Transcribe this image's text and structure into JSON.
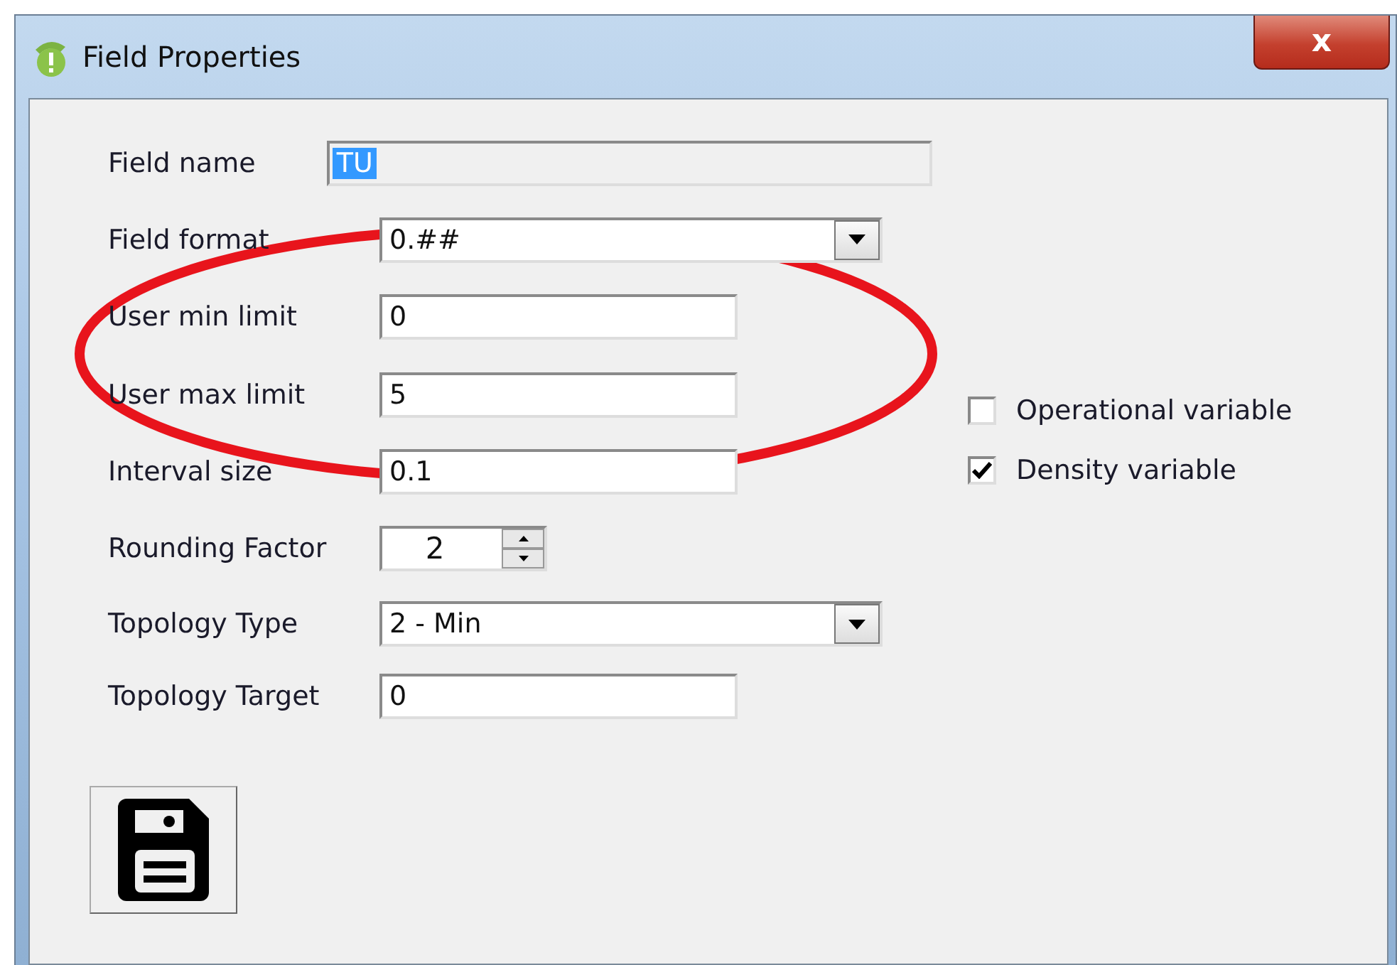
{
  "window": {
    "title": "Field Properties",
    "close_label": "x"
  },
  "fields": [
    {
      "label": "Field name",
      "kind": "text",
      "value": "TU",
      "value_selected": true,
      "disabled": true
    },
    {
      "label": "Field format",
      "kind": "combo",
      "value": "0.##",
      "disabled": false
    },
    {
      "label": "User min limit",
      "kind": "text",
      "value": "0",
      "disabled": false
    },
    {
      "label": "User max limit",
      "kind": "text",
      "value": "5",
      "disabled": false
    },
    {
      "label": "Interval size",
      "kind": "text",
      "value": "0.1",
      "disabled": false
    },
    {
      "label": "Rounding Factor",
      "kind": "spinner",
      "value": "2",
      "disabled": false
    },
    {
      "label": "Topology Type",
      "kind": "combo",
      "value": "2 - Min",
      "disabled": false
    },
    {
      "label": "Topology Target",
      "kind": "text",
      "value": "0",
      "disabled": false
    }
  ],
  "checkboxes": [
    {
      "label": "Operational variable",
      "checked": false
    },
    {
      "label": "Density variable",
      "checked": true
    }
  ],
  "annotation": {
    "kind": "ellipse",
    "color": "#e8141c"
  }
}
